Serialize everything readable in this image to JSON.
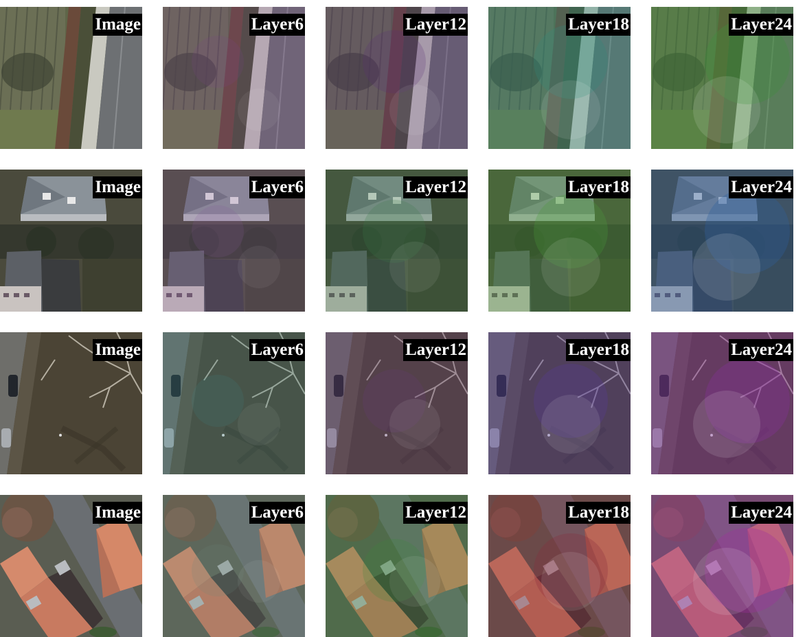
{
  "column_labels": [
    "Image",
    "Layer6",
    "Layer12",
    "Layer18",
    "Layer24"
  ],
  "rows": [
    {
      "scene": "field-road",
      "cells": [
        {
          "label": "Image",
          "tint": null
        },
        {
          "label": "Layer6",
          "tint": "#7a3f8a"
        },
        {
          "label": "Layer12",
          "tint": "#5a2f78"
        },
        {
          "label": "Layer18",
          "tint": "#2f8a7a"
        },
        {
          "label": "Layer24",
          "tint": "#3f8f3a"
        }
      ]
    },
    {
      "scene": "houses-yard",
      "cells": [
        {
          "label": "Image",
          "tint": null
        },
        {
          "label": "Layer6",
          "tint": "#8a5a9a"
        },
        {
          "label": "Layer12",
          "tint": "#3a7a4a"
        },
        {
          "label": "Layer18",
          "tint": "#4a9a3a"
        },
        {
          "label": "Layer24",
          "tint": "#2f5fa0"
        }
      ]
    },
    {
      "scene": "trees-road",
      "cells": [
        {
          "label": "Image",
          "tint": null
        },
        {
          "label": "Layer6",
          "tint": "#3a8a8a"
        },
        {
          "label": "Layer12",
          "tint": "#6a3a7a"
        },
        {
          "label": "Layer18",
          "tint": "#5a3aa0"
        },
        {
          "label": "Layer24",
          "tint": "#8a2fa0"
        }
      ]
    },
    {
      "scene": "roofs-street",
      "cells": [
        {
          "label": "Image",
          "tint": null
        },
        {
          "label": "Layer6",
          "tint": "#6a8a7a"
        },
        {
          "label": "Layer12",
          "tint": "#3a8a3a"
        },
        {
          "label": "Layer18",
          "tint": "#8a2a3a"
        },
        {
          "label": "Layer24",
          "tint": "#a02fa0"
        }
      ]
    }
  ]
}
